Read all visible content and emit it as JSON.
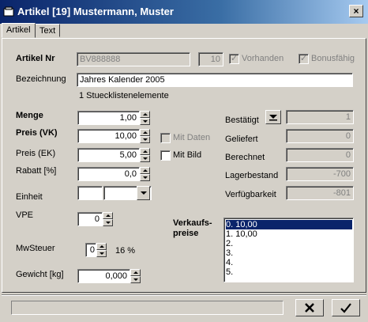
{
  "window": {
    "title": "Artikel [19] Mustermann, Muster",
    "close_symbol": "×"
  },
  "tabs": [
    {
      "label": "Artikel"
    },
    {
      "label": "Text"
    }
  ],
  "form": {
    "artikelnr": {
      "label": "Artikel Nr",
      "value": "BV888888",
      "count": "10"
    },
    "vorhanden": {
      "label": "Vorhanden",
      "checked": true
    },
    "bonusfaehig": {
      "label": "Bonusfähig",
      "checked": true
    },
    "bezeichnung": {
      "label": "Bezeichnung",
      "value": "Jahres Kalender 2005"
    },
    "stueckliste": "1 Stuecklistenelemente",
    "menge": {
      "label": "Menge",
      "value": "1,00"
    },
    "preis_vk": {
      "label": "Preis (VK)",
      "value": "10,00"
    },
    "preis_ek": {
      "label": "Preis (EK)",
      "value": "5,00"
    },
    "rabatt": {
      "label": "Rabatt [%]",
      "value": "0,0"
    },
    "einheit": {
      "label": "Einheit",
      "value": ""
    },
    "vpe": {
      "label": "VPE",
      "value": "0"
    },
    "mwsteuer": {
      "label": "MwSteuer",
      "value": "0",
      "percent": "16 %"
    },
    "gewicht": {
      "label": "Gewicht [kg]",
      "value": "0,000"
    },
    "mit_daten": {
      "label": "Mit Daten",
      "checked": false
    },
    "mit_bild": {
      "label": "Mit Bild",
      "checked": false
    }
  },
  "status": {
    "bestaetigt": {
      "label": "Bestätigt",
      "value": "1"
    },
    "geliefert": {
      "label": "Geliefert",
      "value": "0"
    },
    "berechnet": {
      "label": "Berechnet",
      "value": "0"
    },
    "lagerbestand": {
      "label": "Lagerbestand",
      "value": "-700"
    },
    "verfuegbarkeit": {
      "label": "Verfügbarkeit",
      "value": "-801"
    }
  },
  "verkaufspreise": {
    "label_line1": "Verkaufs-",
    "label_line2": "preise",
    "items": [
      "0.    10,00",
      "1.    10,00",
      "2.",
      "3.",
      "4.",
      "5."
    ],
    "selected_index": 0
  },
  "footer": {
    "status_text": "",
    "cancel_symbol": "✕",
    "ok_symbol": "✓"
  }
}
